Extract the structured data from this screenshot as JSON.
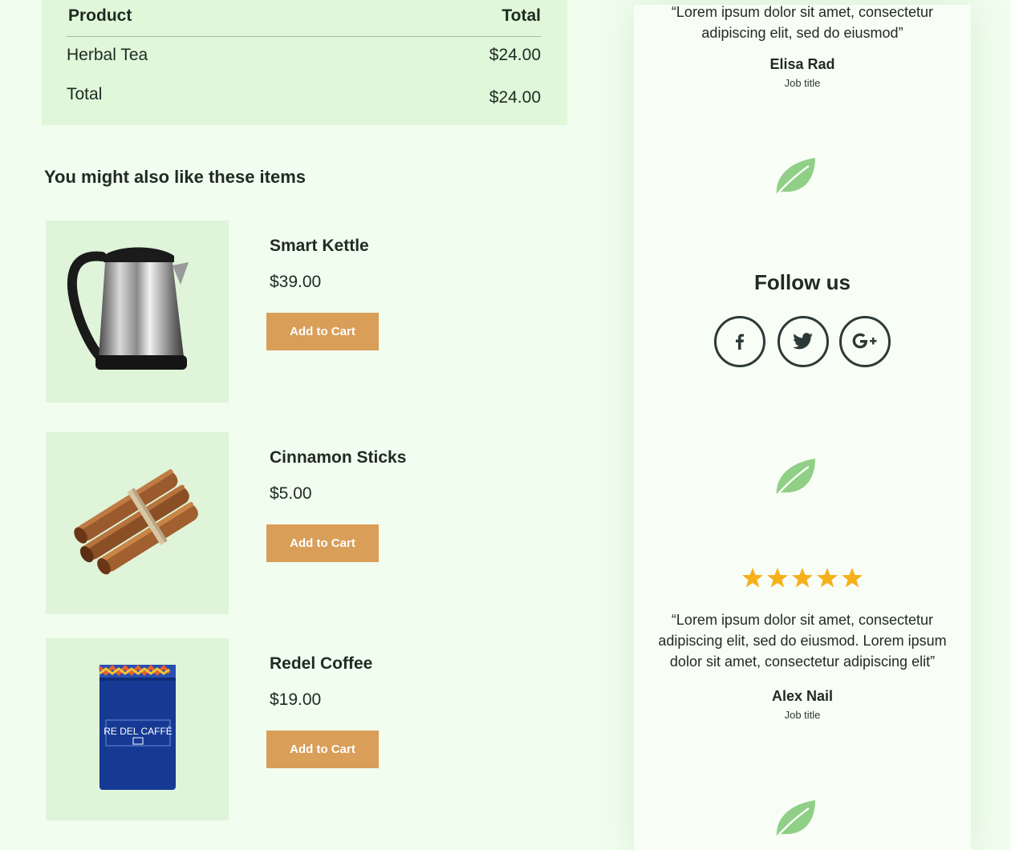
{
  "order_summary": {
    "header": {
      "product": "Product",
      "total": "Total"
    },
    "rows": [
      {
        "label": "Herbal Tea",
        "amount": "$24.00"
      },
      {
        "label": "Total",
        "amount": "$24.00"
      }
    ]
  },
  "related": {
    "title": "You might also like these items",
    "products": [
      {
        "name": "Smart Kettle",
        "price": "$39.00",
        "button": "Add to Cart",
        "image": "kettle"
      },
      {
        "name": "Cinnamon Sticks",
        "price": "$5.00",
        "button": "Add to Cart",
        "image": "cinnamon-sticks"
      },
      {
        "name": "Redel Coffee",
        "price": "$19.00",
        "button": "Add to Cart",
        "image": "coffee-tin",
        "image_label": "RE DEL CAFFÈ"
      }
    ]
  },
  "sidebar": {
    "testimonials": [
      {
        "quote": "“Lorem ipsum dolor sit amet, consectetur adipiscing elit, sed do eiusmod”",
        "author": "Elisa Rad",
        "job_title": "Job title"
      },
      {
        "quote": "“Lorem ipsum dolor sit amet, consectetur adipiscing elit, sed do eiusmod. Lorem ipsum dolor sit amet, consectetur adipiscing elit”",
        "author": "Alex Nail",
        "job_title": "Job title",
        "rating": 5
      }
    ],
    "follow": {
      "title": "Follow us",
      "networks": [
        {
          "icon": "facebook-icon"
        },
        {
          "icon": "twitter-icon"
        },
        {
          "icon": "google-plus-icon"
        }
      ]
    },
    "leaf_icon": "leaf-icon"
  },
  "colors": {
    "page_background": "#f1fdef",
    "table_background": "#e0f7da",
    "thumbnail_background": "#dff4d9",
    "button": "#d99e57",
    "leaf": "#8fcf86",
    "star": "#f6b01c",
    "text": "#1f2a22"
  }
}
